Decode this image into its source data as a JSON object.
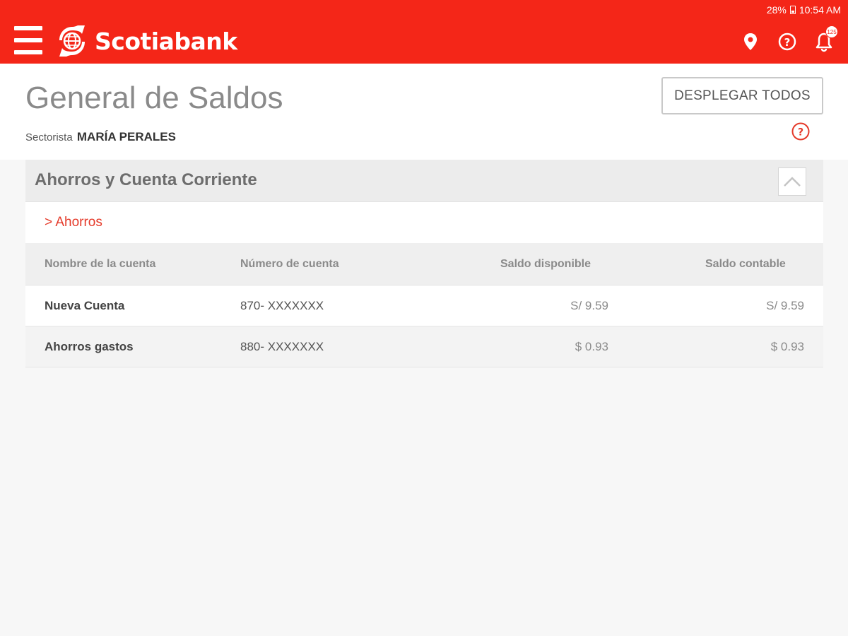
{
  "status_bar": {
    "battery": "28%",
    "time": "10:54 AM"
  },
  "header": {
    "brand": "Scotiabank",
    "brand_color": "#f42618",
    "notification_count": "125",
    "icons": [
      "menu-icon",
      "location-pin-icon",
      "help-icon",
      "bell-icon"
    ]
  },
  "page": {
    "title": "General de Saldos",
    "sectorista_label": "Sectorista",
    "sectorista_name": "MARÍA PERALES",
    "expand_all_label": "DESPLEGAR TODOS"
  },
  "section": {
    "title": "Ahorros y Cuenta Corriente",
    "subsection": "> Ahorros",
    "columns": [
      "Nombre de la cuenta",
      "Número de cuenta",
      "Saldo disponible",
      "Saldo contable"
    ],
    "rows": [
      {
        "name": "Nueva Cuenta",
        "number": "870- XXXXXXX",
        "available": "S/ 9.59",
        "accounting": "S/ 9.59"
      },
      {
        "name": "Ahorros gastos",
        "number": "880- XXXXXXX",
        "available": "$ 0.93",
        "accounting": "$ 0.93"
      }
    ]
  }
}
